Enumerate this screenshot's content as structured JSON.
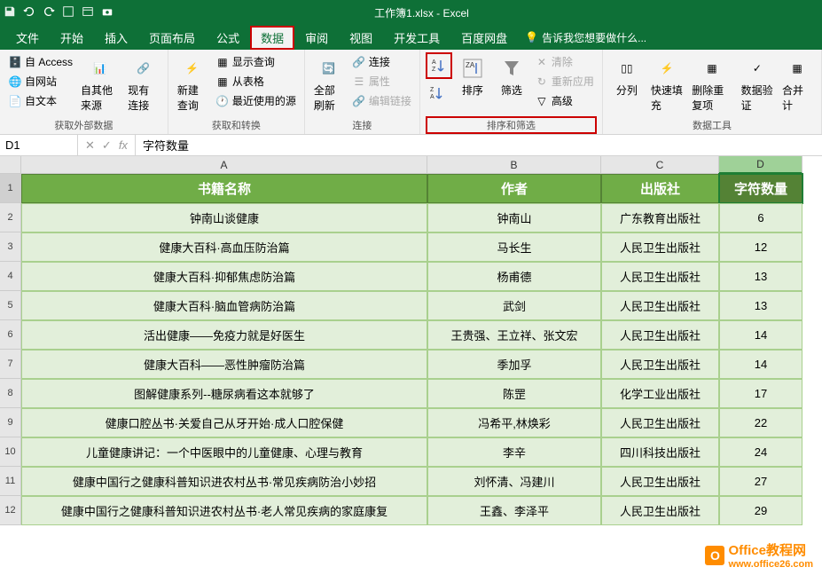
{
  "title": "工作簿1.xlsx - Excel",
  "menus": [
    "文件",
    "开始",
    "插入",
    "页面布局",
    "公式",
    "数据",
    "审阅",
    "视图",
    "开发工具",
    "百度网盘"
  ],
  "active_menu": "数据",
  "tell_me": "告诉我您想要做什么...",
  "ribbon": {
    "external": {
      "access": "自 Access",
      "web": "自网站",
      "text": "自文本",
      "other": "自其他来源",
      "existing": "现有连接",
      "label": "获取外部数据"
    },
    "transform": {
      "new_query": "新建查询",
      "show_query": "显示查询",
      "from_table": "从表格",
      "recent": "最近使用的源",
      "label": "获取和转换"
    },
    "connections": {
      "refresh": "全部刷新",
      "conn": "连接",
      "props": "属性",
      "edit_links": "编辑链接",
      "label": "连接"
    },
    "sort_filter": {
      "sort": "排序",
      "filter": "筛选",
      "clear": "清除",
      "reapply": "重新应用",
      "advanced": "高级",
      "label": "排序和筛选"
    },
    "data_tools": {
      "text_cols": "分列",
      "flash_fill": "快速填充",
      "remove_dup": "删除重复项",
      "data_val": "数据验证",
      "consolidate": "合并计",
      "label": "数据工具"
    }
  },
  "name_box": "D1",
  "formula_value": "字符数量",
  "columns": [
    "A",
    "B",
    "C",
    "D"
  ],
  "headers": {
    "a": "书籍名称",
    "b": "作者",
    "c": "出版社",
    "d": "字符数量"
  },
  "rows": [
    {
      "a": "钟南山谈健康",
      "b": "钟南山",
      "c": "广东教育出版社",
      "d": "6"
    },
    {
      "a": "健康大百科·高血压防治篇",
      "b": "马长生",
      "c": "人民卫生出版社",
      "d": "12"
    },
    {
      "a": "健康大百科·抑郁焦虑防治篇",
      "b": "杨甫德",
      "c": "人民卫生出版社",
      "d": "13"
    },
    {
      "a": "健康大百科·脑血管病防治篇",
      "b": "武剑",
      "c": "人民卫生出版社",
      "d": "13"
    },
    {
      "a": "活出健康——免疫力就是好医生",
      "b": "王贵强、王立祥、张文宏",
      "c": "人民卫生出版社",
      "d": "14"
    },
    {
      "a": "健康大百科——恶性肿瘤防治篇",
      "b": "季加孚",
      "c": "人民卫生出版社",
      "d": "14"
    },
    {
      "a": "图解健康系列--糖尿病看这本就够了",
      "b": "陈罡",
      "c": "化学工业出版社",
      "d": "17"
    },
    {
      "a": "健康口腔丛书·关爱自己从牙开始·成人口腔保健",
      "b": "冯希平,林焕彩",
      "c": "人民卫生出版社",
      "d": "22"
    },
    {
      "a": "儿童健康讲记：一个中医眼中的儿童健康、心理与教育",
      "b": "李辛",
      "c": "四川科技出版社",
      "d": "24"
    },
    {
      "a": "健康中国行之健康科普知识进农村丛书·常见疾病防治小妙招",
      "b": "刘怀清、冯建川",
      "c": "人民卫生出版社",
      "d": "27"
    },
    {
      "a": "健康中国行之健康科普知识进农村丛书·老人常见疾病的家庭康复",
      "b": "王鑫、李泽平",
      "c": "人民卫生出版社",
      "d": "29"
    }
  ],
  "watermark": {
    "title": "Office教程网",
    "url": "www.office26.com"
  }
}
